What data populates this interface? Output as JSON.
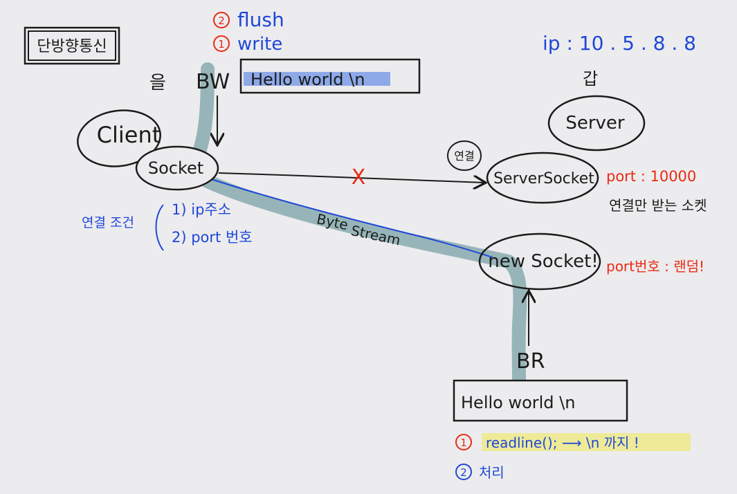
{
  "title_box": "단방향통신",
  "particle": "을",
  "bw_label": "BW",
  "br_label": "BR",
  "write_buffer": "Hello world \\n",
  "read_buffer": "Hello world  \\n",
  "steps_top": [
    {
      "num": "2",
      "text": "flush"
    },
    {
      "num": "1",
      "text": "write"
    }
  ],
  "client_label": "Client",
  "socket_label": "Socket",
  "server_ip": "ip : 10 . 5 . 8 . 8",
  "server_suffix": "갑",
  "server_label": "Server",
  "connect_label": "연결",
  "cross_mark": "X",
  "serversocket_label": "ServerSocket",
  "server_port": "port : 10000",
  "serversocket_note": "연결만 받는 소켓",
  "conditions_label": "연결 조건",
  "conditions": [
    "1)  ip주소",
    "2)  port 번호"
  ],
  "stream_label_1": "Byte",
  "stream_label_2": "Stream",
  "newsocket_label": "new Socket!",
  "newsocket_port": "port번호 : 랜덤!",
  "steps_bottom": [
    {
      "num": "1",
      "text": "readline();  ⟶  \\n 까지 !"
    },
    {
      "num": "2",
      "text": "처리"
    }
  ],
  "colors": {
    "ink": "#1b1b1b",
    "blue": "#1f47d8",
    "red": "#ea2a12",
    "stream_band": "#8fb0b3",
    "highlight_blue": "#7e9ee6",
    "highlight_yellow": "#eeea8e"
  }
}
